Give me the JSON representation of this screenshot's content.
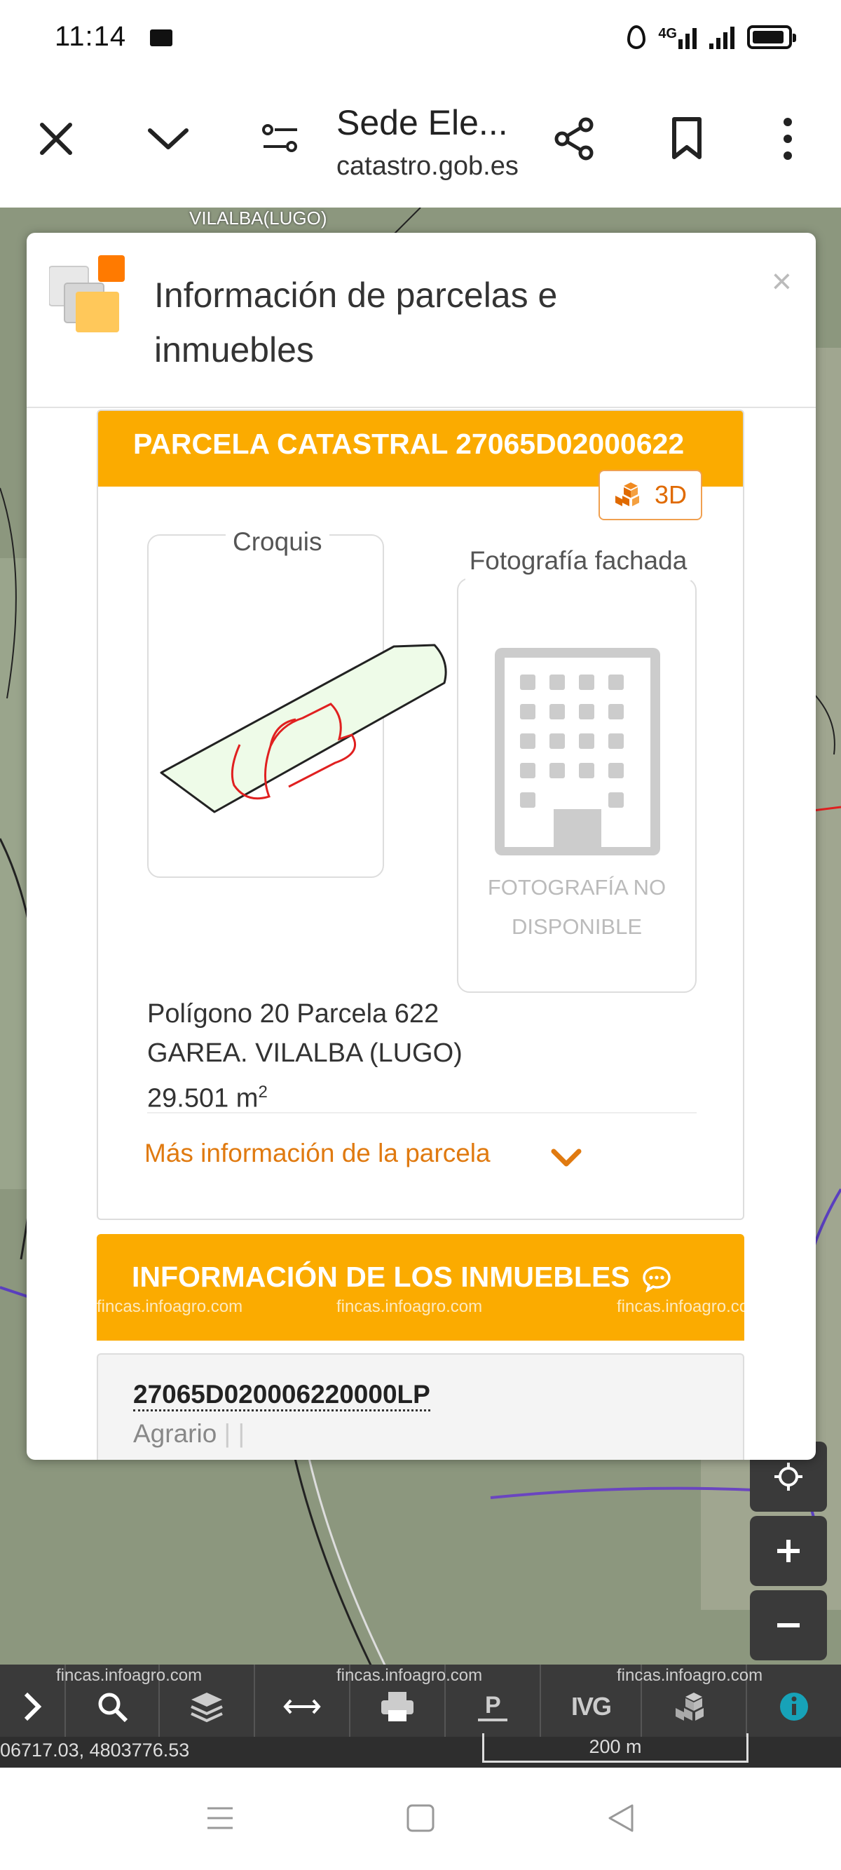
{
  "status_bar": {
    "time": "11:14",
    "network": "4G",
    "icons": [
      "mail-icon",
      "water-drop-icon",
      "signal-icon",
      "battery-icon"
    ]
  },
  "browser": {
    "title": "Sede Ele...",
    "url": "catastro.gob.es",
    "buttons": [
      "close-icon",
      "chevron-down-icon",
      "site-settings-icon",
      "share-icon",
      "bookmark-icon",
      "more-vert-icon"
    ]
  },
  "map": {
    "place_label": "VILALBA(LUGO)",
    "coordinates": "06717.03, 4803776.53",
    "scale_label": "200 m",
    "toolbar_items": [
      "chevron-right-icon",
      "search-icon",
      "layers-icon",
      "measure-icon",
      "print-icon",
      "parking-icon",
      "ivg-icon",
      "3d-cubes-icon",
      "info-icon"
    ],
    "ivg_label": "IVG",
    "zoom_controls": [
      "locate-icon",
      "plus-icon",
      "minus-icon"
    ],
    "watermark": "fincas.infoagro.com"
  },
  "modal": {
    "title": "Información de parcelas e inmuebles",
    "close_label": "×",
    "parcel": {
      "header": "PARCELA CATASTRAL 27065D02000622",
      "btn_3d": "3D",
      "croquis_label": "Croquis",
      "foto_label": "Fotografía fachada",
      "foto_unavailable": "FOTOGRAFÍA NO DISPONIBLE",
      "location_line1": "Polígono 20 Parcela 622",
      "location_line2": "GAREA. VILALBA (LUGO)",
      "area": "29.501 m",
      "area_unit_sup": "2",
      "more_info": "Más información de la parcela"
    },
    "inmuebles": {
      "header": "INFORMACIÓN DE LOS INMUEBLES",
      "ref": "27065D020006220000LP",
      "use": "Agrario",
      "use_sep": " | |"
    }
  },
  "colors": {
    "accent_orange": "#fbab00",
    "link_orange": "#e07a10",
    "map_bar": "#3a3a3a"
  }
}
